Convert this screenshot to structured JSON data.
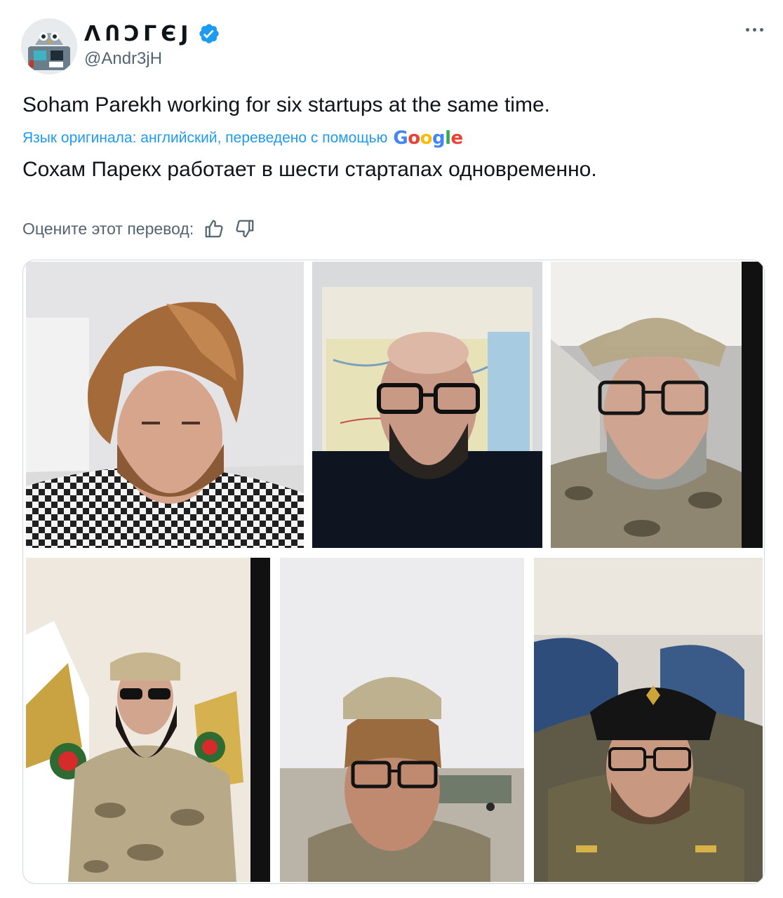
{
  "author": {
    "display_name": "ΛՈϽΓЄЈ",
    "handle": "@Andr3jH",
    "verified": true,
    "avatar_icon": "owl-robot-avatar"
  },
  "tweet": {
    "text": "Soham Parekh working for six startups at the same time.",
    "translation_note": "Язык оригинала: английский, переведено с помощью",
    "translation_provider": "Google",
    "translated_text": "Сохам Парекх работает в шести стартапах одновременно.",
    "rate_label": "Оцените этот перевод:"
  },
  "icons": {
    "more": "more-dots-icon",
    "verified": "verified-badge-icon",
    "thumbs_up": "thumbs-up-icon",
    "thumbs_down": "thumbs-down-icon"
  },
  "colors": {
    "accent": "#1d9bf0",
    "secondary_text": "#536471",
    "border": "#cfd9de"
  },
  "media": [
    {
      "id": "photo-1",
      "description_icon": "photo-icon"
    },
    {
      "id": "photo-2",
      "description_icon": "photo-icon"
    },
    {
      "id": "photo-3",
      "description_icon": "photo-icon"
    },
    {
      "id": "photo-4",
      "description_icon": "photo-icon"
    },
    {
      "id": "photo-5",
      "description_icon": "photo-icon"
    },
    {
      "id": "photo-6",
      "description_icon": "photo-icon"
    }
  ]
}
